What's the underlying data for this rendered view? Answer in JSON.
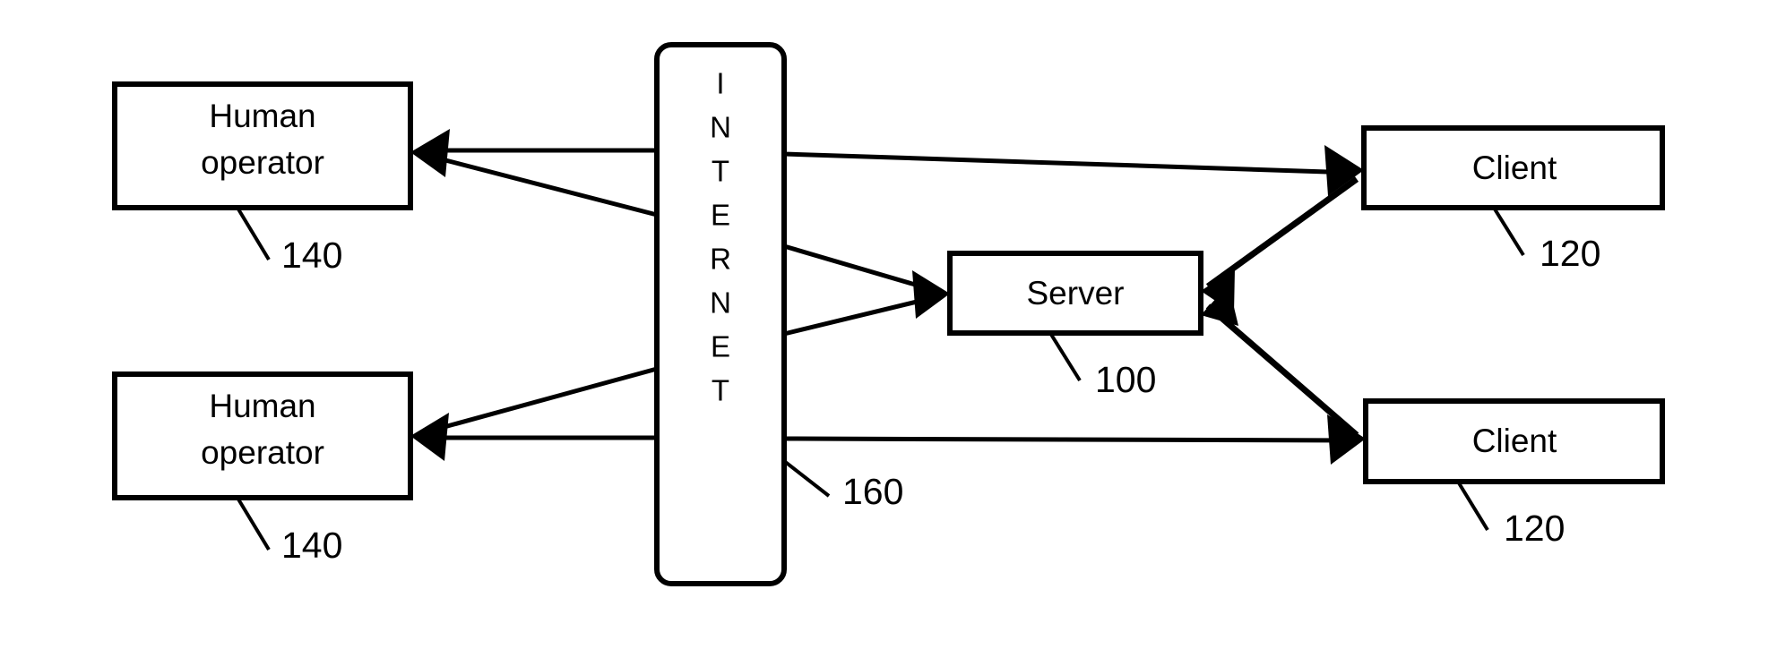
{
  "figure": {
    "background_color": "#ffffff",
    "line_color": "#000000",
    "nodes": {
      "human_operator_top": {
        "label": "Human operator",
        "label_line1": "Human",
        "label_line2": "operator",
        "ref": "140"
      },
      "human_operator_bottom": {
        "label": "Human operator",
        "label_line1": "Human",
        "label_line2": "operator",
        "ref": "140"
      },
      "internet": {
        "label": "INTERNET",
        "letters": [
          "I",
          "N",
          "T",
          "E",
          "R",
          "N",
          "E",
          "T"
        ],
        "ref": "160"
      },
      "server": {
        "label": "Server",
        "ref": "100"
      },
      "client_top": {
        "label": "Client",
        "ref": "120"
      },
      "client_bottom": {
        "label": "Client",
        "ref": "120"
      }
    },
    "connections": [
      {
        "from": "internet",
        "to": "human_operator_top",
        "direction": "one-way"
      },
      {
        "from": "internet",
        "to": "human_operator_top",
        "direction": "one-way"
      },
      {
        "from": "internet",
        "to": "human_operator_bottom",
        "direction": "one-way"
      },
      {
        "from": "internet",
        "to": "human_operator_bottom",
        "direction": "one-way"
      },
      {
        "from": "internet",
        "to": "client_top",
        "direction": "one-way"
      },
      {
        "from": "internet",
        "to": "client_bottom",
        "direction": "one-way"
      },
      {
        "from": "internet",
        "to": "server",
        "direction": "one-way"
      },
      {
        "from": "internet",
        "to": "server",
        "direction": "one-way"
      },
      {
        "from": "server",
        "to": "client_top",
        "direction": "two-way"
      },
      {
        "from": "server",
        "to": "client_bottom",
        "direction": "two-way"
      }
    ]
  }
}
